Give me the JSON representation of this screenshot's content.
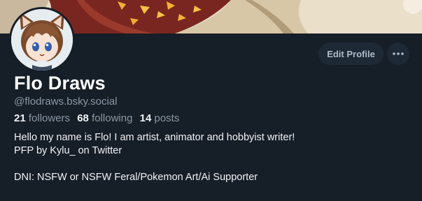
{
  "profile": {
    "display_name": "Flo Draws",
    "handle": "@flodraws.bsky.social",
    "followers_count": "21",
    "followers_label": "followers",
    "following_count": "68",
    "following_label": "following",
    "posts_count": "14",
    "posts_label": "posts",
    "bio_lines": [
      "Hello my name is Flo! I am artist, animator and hobbyist writer!",
      "PFP by Kylu_ on Twitter",
      "",
      "DNI: NSFW or NSFW Feral/Pokemon Art/Ai Supporter"
    ]
  },
  "actions": {
    "edit_profile_label": "Edit Profile",
    "more_icon": "ellipsis-icon"
  },
  "colors": {
    "background": "#161e27",
    "button_bg": "#1e2936",
    "muted_text": "#8b98a5",
    "primary_text": "#f1f3f5"
  }
}
